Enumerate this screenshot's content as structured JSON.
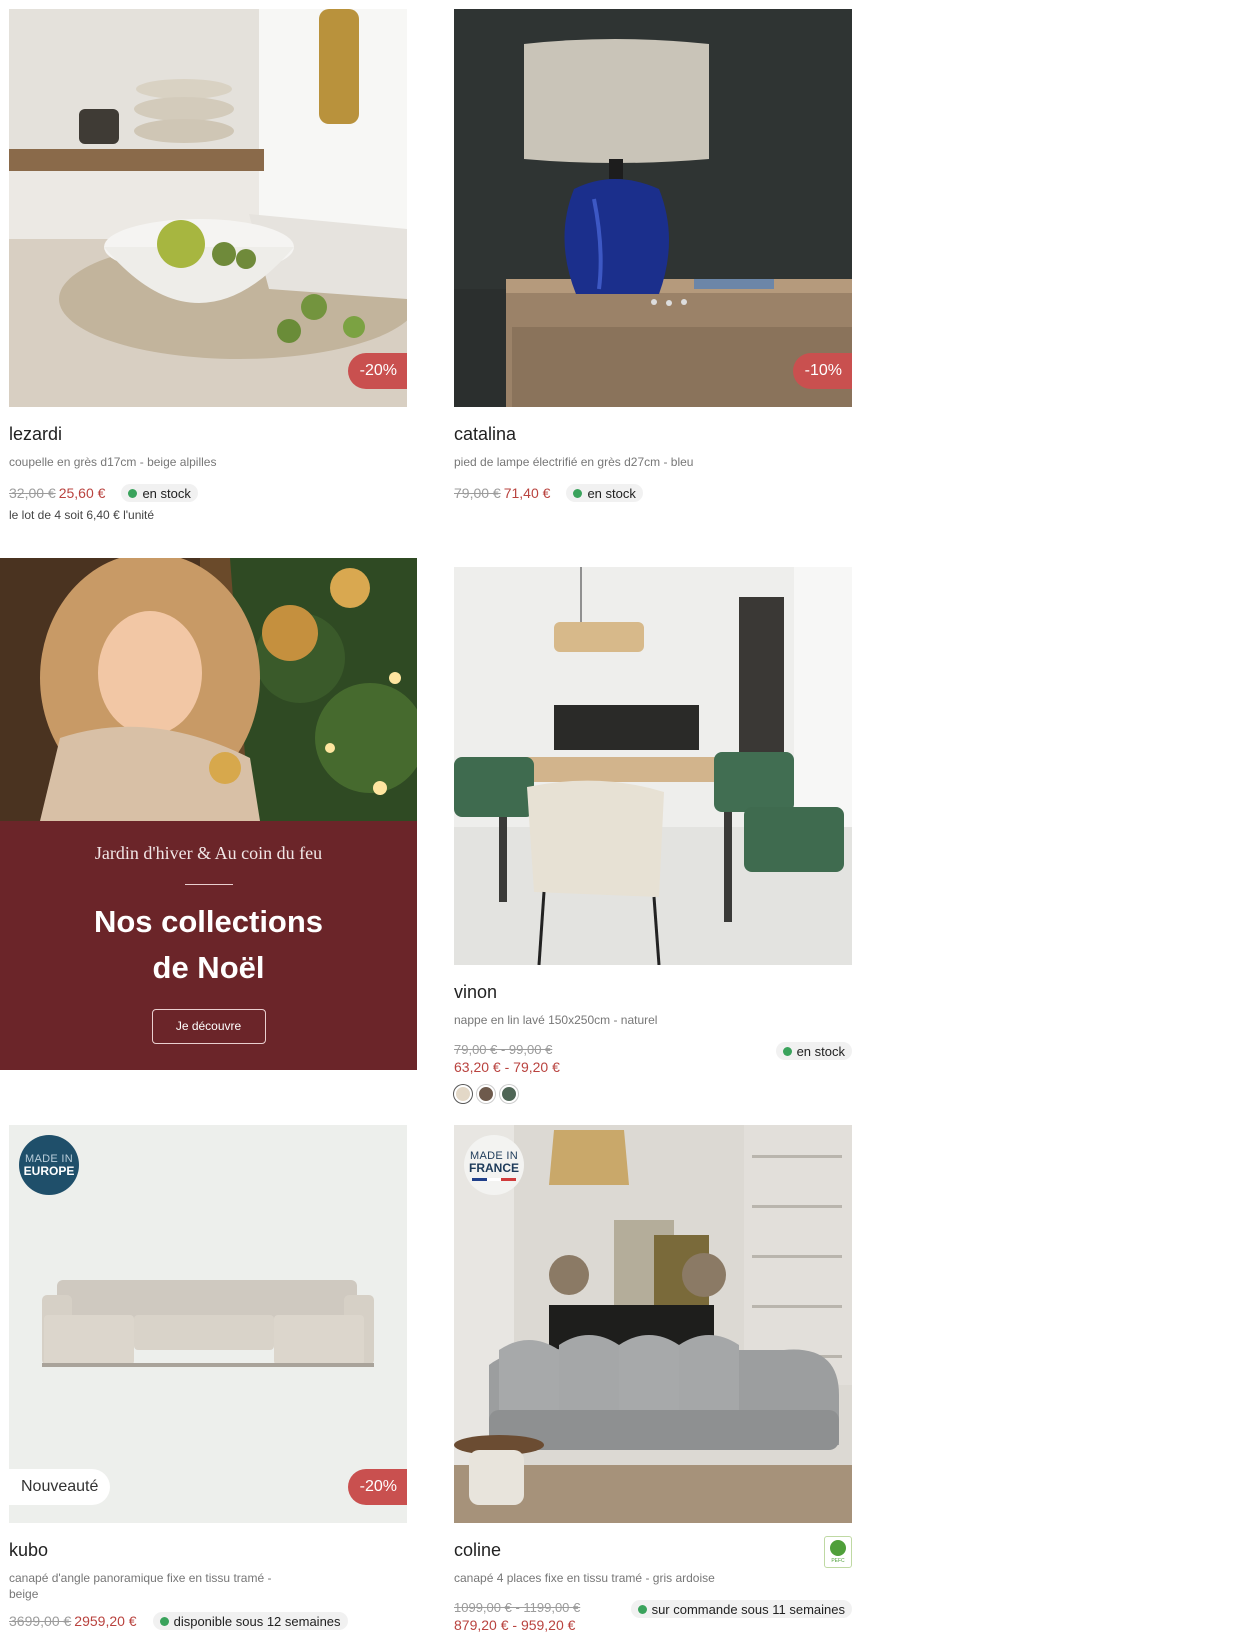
{
  "products": [
    {
      "name": "lezardi",
      "description": "coupelle en grès d17cm - beige alpilles",
      "old_price": "32,00 €",
      "new_price": "25,60 €",
      "discount": "-20%",
      "stock": "en stock",
      "unit_note": "le lot de 4 soit 6,40 € l'unité"
    },
    {
      "name": "catalina",
      "description": "pied de lampe électrifié en grès d27cm - bleu",
      "old_price": "79,00 €",
      "new_price": "71,40 €",
      "discount": "-10%",
      "stock": "en stock"
    },
    {
      "name": "vinon",
      "description": "nappe en lin lavé 150x250cm - naturel",
      "old_price": "79,00 € - 99,00 €",
      "new_price": "63,20 € - 79,20 €",
      "stock": "en stock",
      "swatches": [
        "#e3d8c7",
        "#6e5a4c",
        "#4f6656"
      ]
    },
    {
      "name": "kubo",
      "description": "canapé d'angle panoramique fixe en tissu tramé - beige",
      "old_price": "3699,00 €",
      "new_price": "2959,20 €",
      "discount": "-20%",
      "stock": "disponible sous 12 semaines",
      "badge_new": "Nouveauté",
      "made_in": {
        "line1": "MADE IN",
        "line2": "EUROPE"
      }
    },
    {
      "name": "coline",
      "description": "canapé 4 places fixe en tissu tramé - gris ardoise",
      "old_price": "1099,00 € - 1199,00 €",
      "new_price": "879,20 € - 959,20 €",
      "stock": "sur commande sous 11 semaines",
      "made_in": {
        "line1": "MADE IN",
        "line2": "FRANCE"
      },
      "certification": "PEFC"
    }
  ],
  "promo": {
    "kicker": "Jardin d'hiver & Au coin du feu",
    "title_line1": "Nos collections",
    "title_line2": "de Noël",
    "button": "Je découvre"
  },
  "colors": {
    "discount_badge": "#c9504f",
    "sale_price": "#b9433f",
    "stock_dot": "#3aa35c",
    "promo_panel": "#6b2529"
  }
}
